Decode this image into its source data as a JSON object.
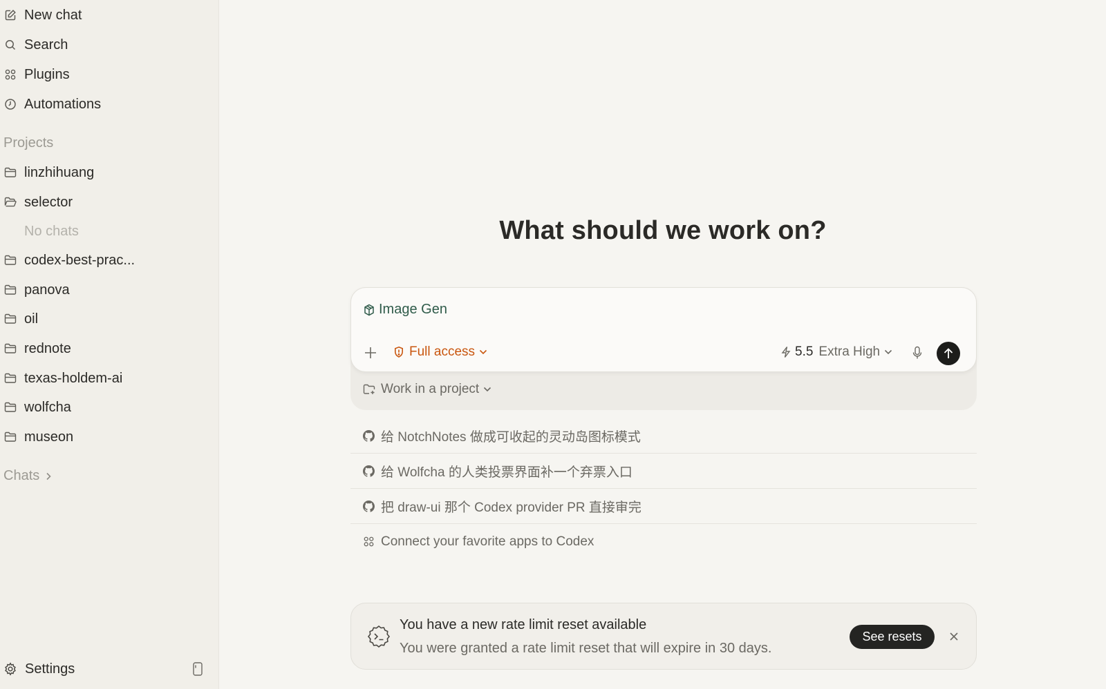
{
  "sidebar": {
    "nav": [
      {
        "label": "New chat",
        "icon": "edit-icon"
      },
      {
        "label": "Search",
        "icon": "search-icon"
      },
      {
        "label": "Plugins",
        "icon": "grid-icon"
      },
      {
        "label": "Automations",
        "icon": "clock-icon"
      }
    ],
    "projects_label": "Projects",
    "projects": [
      {
        "label": "linzhihuang"
      },
      {
        "label": "selector"
      },
      {
        "label": "codex-best-prac..."
      },
      {
        "label": "panova"
      },
      {
        "label": "oil"
      },
      {
        "label": "rednote"
      },
      {
        "label": "texas-holdem-ai"
      },
      {
        "label": "wolfcha"
      },
      {
        "label": "museon"
      }
    ],
    "no_chats": "No chats",
    "chats_label": "Chats",
    "settings_label": "Settings"
  },
  "main": {
    "headline": "What should we work on?",
    "composer": {
      "chip_label": "Image Gen",
      "access_label": "Full access",
      "model_version": "5.5",
      "model_effort": "Extra High",
      "project_label": "Work in a project"
    },
    "suggestions": [
      {
        "label": "给 NotchNotes 做成可收起的灵动岛图标模式",
        "icon": "github-icon"
      },
      {
        "label": "给 Wolfcha 的人类投票界面补一个弃票入口",
        "icon": "github-icon"
      },
      {
        "label": "把 draw-ui 那个 Codex provider PR 直接审完",
        "icon": "github-icon"
      },
      {
        "label": "Connect your favorite apps to Codex",
        "icon": "grid-icon"
      }
    ],
    "notice": {
      "title": "You have a new rate limit reset available",
      "body": "You were granted a rate limit reset that will expire in 30 days.",
      "button_label": "See resets"
    }
  },
  "colors": {
    "accent_access": "#c9560f",
    "chip_green": "#2f5b4a",
    "send_button": "#1d1d1b"
  }
}
